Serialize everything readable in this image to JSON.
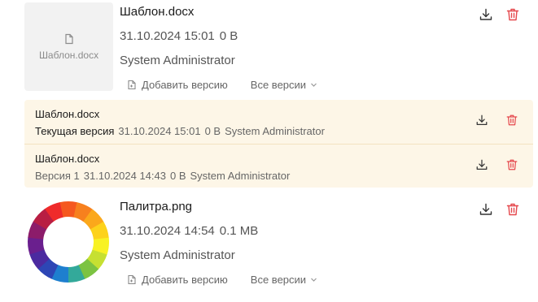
{
  "files": [
    {
      "name": "Шаблон.docx",
      "thumbnail_label": "Шаблон.docx",
      "thumbnail_icon": "document-icon",
      "date": "31.10.2024 15:01",
      "size": "0 В",
      "author": "System Administrator",
      "add_version_label": "Добавить версию",
      "all_versions_label": "Все версии"
    },
    {
      "name": "Палитра.png",
      "thumbnail_icon": "color-wheel-image",
      "date": "31.10.2024 14:54",
      "size": "0.1 MB",
      "author": "System Administrator",
      "add_version_label": "Добавить версию",
      "all_versions_label": "Все версии"
    }
  ],
  "versions": [
    {
      "name": "Шаблон.docx",
      "label": "Текущая версия",
      "date": "31.10.2024 15:01",
      "size": "0 В",
      "author": "System Administrator"
    },
    {
      "name": "Шаблон.docx",
      "label": "Версия 1",
      "date": "31.10.2024 14:43",
      "size": "0 В",
      "author": "System Administrator"
    }
  ],
  "colors": {
    "delete": "#e5484d",
    "download": "#333333",
    "versions_bg": "#fdf6e7"
  },
  "icons": [
    "download-icon",
    "trash-icon",
    "add-version-icon",
    "chevron-down-icon",
    "document-icon"
  ]
}
